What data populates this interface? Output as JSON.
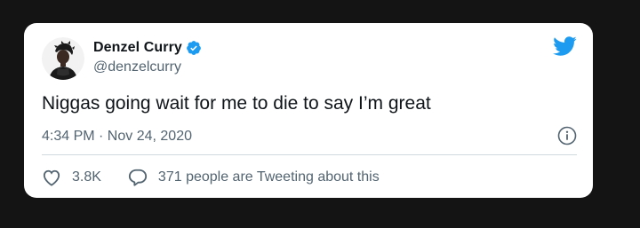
{
  "tweet": {
    "author": {
      "display_name": "Denzel Curry",
      "handle": "@denzelcurry",
      "verified_icon": "verified-badge-icon"
    },
    "brand_icon": "twitter-bird-icon",
    "text": "Niggas going wait for me to die to say I’m great",
    "timestamp": "4:34 PM · Nov 24, 2020",
    "info_icon": "info-icon",
    "actions": {
      "like_icon": "heart-icon",
      "like_count": "3.8K",
      "reply_icon": "speech-bubble-icon",
      "reply_label": "371 people are Tweeting about this"
    }
  },
  "colors": {
    "background": "#141414",
    "card": "#ffffff",
    "primary_text": "#0f1419",
    "secondary_text": "#536471",
    "twitter_blue": "#1d9bf0"
  }
}
